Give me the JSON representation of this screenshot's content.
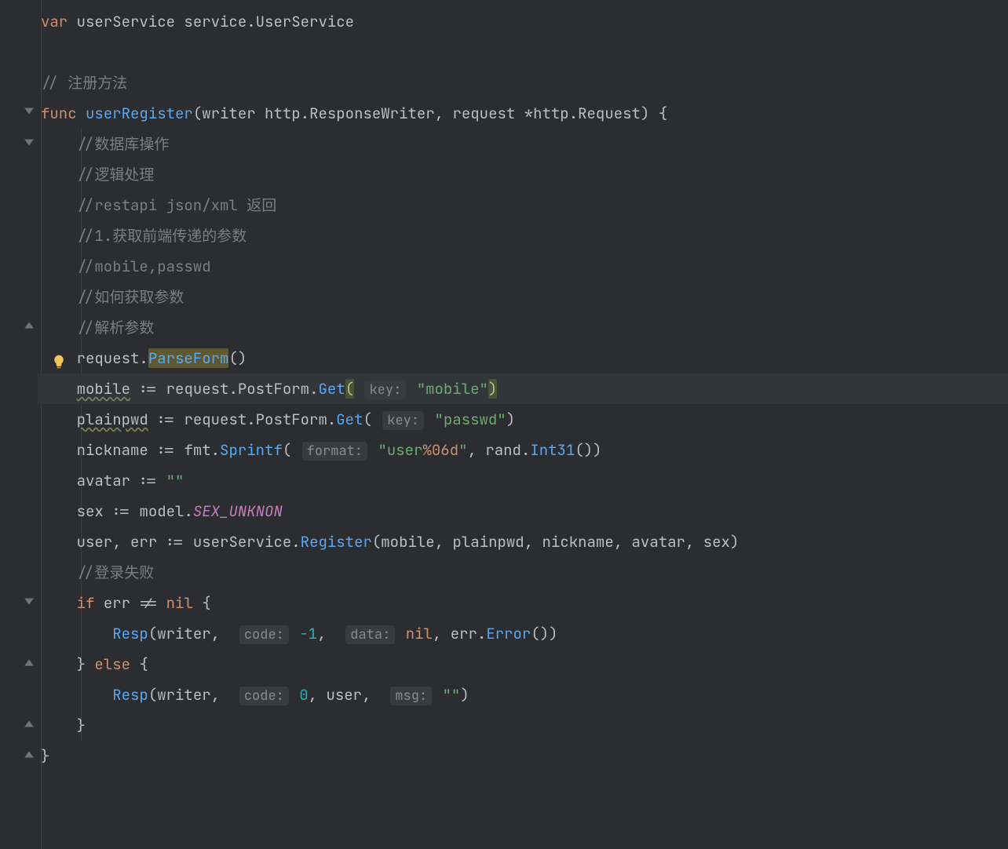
{
  "tokens": {
    "var": "var",
    "func": "func",
    "if": "if",
    "else": "else",
    "nil": "nil",
    "userService": "userService",
    "service": "service",
    "UserService": "UserService",
    "userRegister": "userRegister",
    "writer": "writer",
    "http": "http",
    "ResponseWriter": "ResponseWriter",
    "request": "request",
    "Request": "Request",
    "ParseForm": "ParseForm",
    "mobile": "mobile",
    "PostForm": "PostForm",
    "Get": "Get",
    "plainpwd": "plainpwd",
    "nickname": "nickname",
    "fmt": "fmt",
    "Sprintf": "Sprintf",
    "rand": "rand",
    "Int31": "Int31",
    "avatar": "avatar",
    "sex": "sex",
    "model": "model",
    "SEX_UNKNON": "SEX_UNKNON",
    "user": "user",
    "err": "err",
    "Register": "Register",
    "Resp": "Resp",
    "Error": "Error",
    "ne": "!=",
    "assign": ":=",
    "star": "*",
    "lbrace": "{",
    "rbrace": "}",
    "comma": ",",
    "dot": ".",
    "lparen": "(",
    "rparen": ")"
  },
  "hints": {
    "key": "key:",
    "format": "format:",
    "code": "code:",
    "data": "data:",
    "msg": "msg:"
  },
  "strings": {
    "mobile": "\"mobile\"",
    "passwd": "\"passwd\"",
    "userfmt_a": "\"user",
    "userfmt_b": "%06d",
    "userfmt_c": "\"",
    "empty": "\"\""
  },
  "numbers": {
    "neg1": "-1",
    "zero": "0"
  },
  "comments": {
    "c1": "// 注册方法",
    "c2": "//数据库操作",
    "c3": "//逻辑处理",
    "c4": "//restapi json/xml 返回",
    "c5": "//1.获取前端传递的参数",
    "c6": "//mobile,passwd",
    "c7": "//如何获取参数",
    "c8": "//解析参数",
    "c9": "//登录失败"
  },
  "indent": {
    "i1": "    ",
    "i2": "        "
  }
}
